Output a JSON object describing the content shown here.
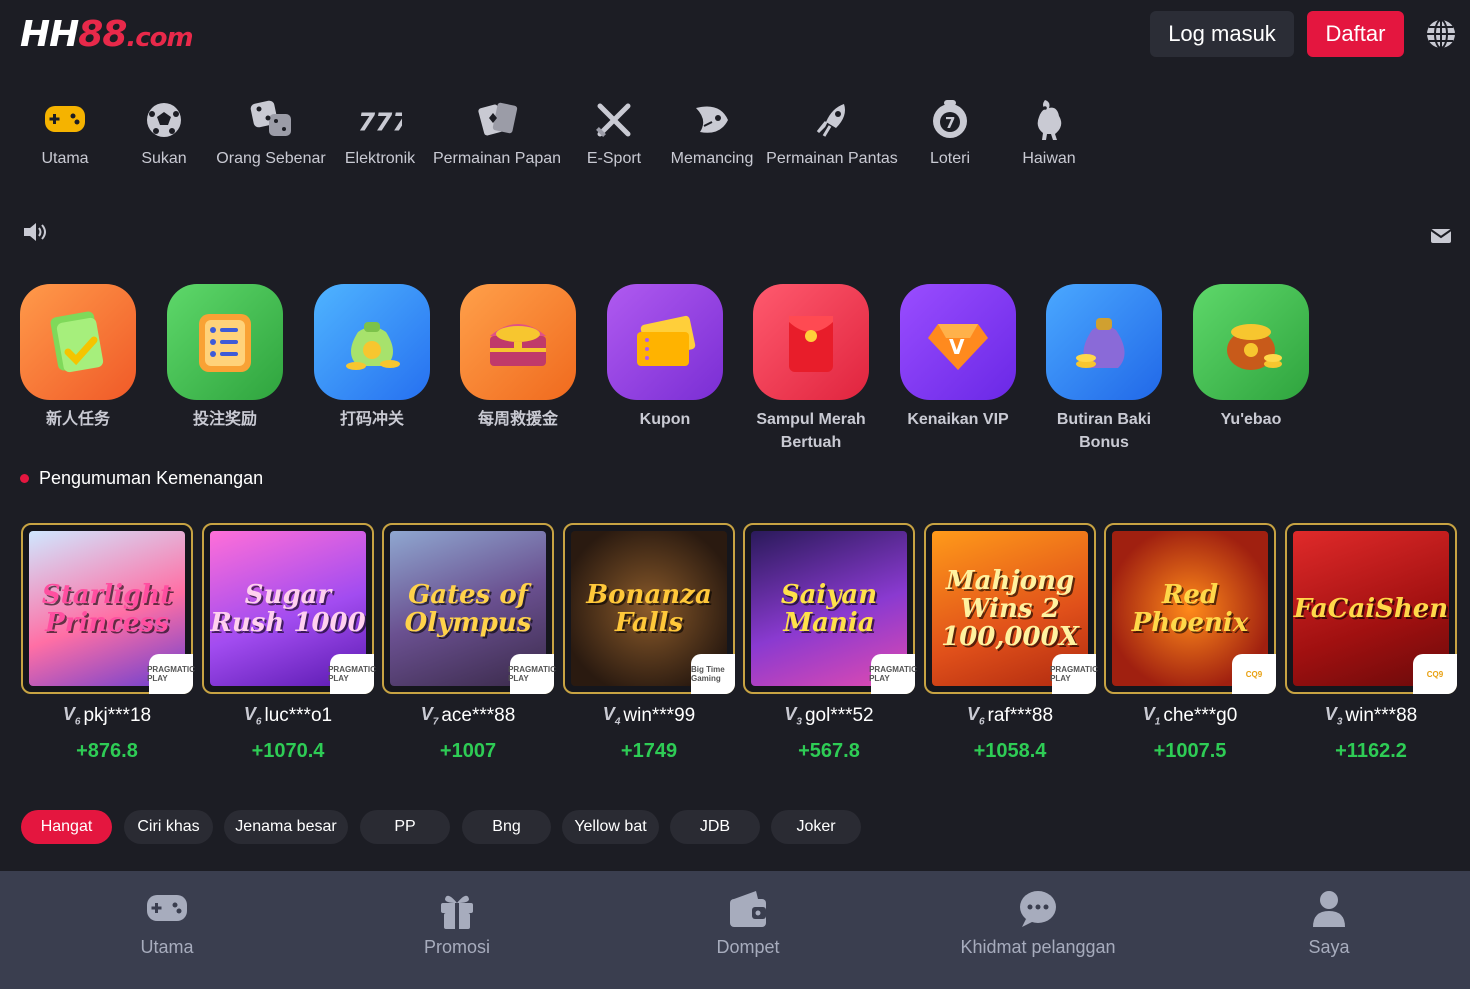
{
  "header": {
    "logo": {
      "part1": "HH",
      "part2": "88",
      "part3": ".com"
    },
    "login_label": "Log masuk",
    "register_label": "Daftar"
  },
  "categories": [
    {
      "label": "Utama",
      "icon": "gamepad-icon"
    },
    {
      "label": "Sukan",
      "icon": "soccer-ball-icon"
    },
    {
      "label": "Orang Sebenar",
      "icon": "dice-icon"
    },
    {
      "label": "Elektronik",
      "icon": "slot-777-icon"
    },
    {
      "label": "Permainan Papan",
      "icon": "cards-icon"
    },
    {
      "label": "E-Sport",
      "icon": "crossed-swords-icon"
    },
    {
      "label": "Memancing",
      "icon": "fish-icon"
    },
    {
      "label": "Permainan Pantas",
      "icon": "rocket-icon"
    },
    {
      "label": "Loteri",
      "icon": "lottery-ball-icon"
    },
    {
      "label": "Haiwan",
      "icon": "rooster-icon"
    }
  ],
  "promos": [
    {
      "label": "新人任务",
      "icon": "checklist-icon"
    },
    {
      "label": "投注奖励",
      "icon": "list-icon"
    },
    {
      "label": "打码冲关",
      "icon": "money-bag-icon"
    },
    {
      "label": "每周救援金",
      "icon": "treasure-chest-icon"
    },
    {
      "label": "Kupon",
      "icon": "coupon-icon"
    },
    {
      "label": "Sampul Merah Bertuah",
      "icon": "red-envelope-icon"
    },
    {
      "label": "Kenaikan VIP",
      "icon": "vip-diamond-icon"
    },
    {
      "label": "Butiran Baki Bonus",
      "icon": "coin-bag-icon"
    },
    {
      "label": "Yu'ebao",
      "icon": "gold-pot-icon"
    }
  ],
  "announcement_title": "Pengumuman Kemenangan",
  "winners": [
    {
      "game": "Starlight Princess",
      "vip": "6",
      "user": "pkj***18",
      "amount": "+876.8",
      "provider": "PRAGMATIC PLAY"
    },
    {
      "game": "Sugar Rush 1000",
      "vip": "6",
      "user": "luc***o1",
      "amount": "+1070.4",
      "provider": "PRAGMATIC PLAY"
    },
    {
      "game": "Gates of Olympus",
      "vip": "7",
      "user": "ace***88",
      "amount": "+1007",
      "provider": "PRAGMATIC PLAY"
    },
    {
      "game": "Bonanza Falls",
      "vip": "4",
      "user": "win***99",
      "amount": "+1749",
      "provider": "Big Time Gaming"
    },
    {
      "game": "Saiyan Mania",
      "vip": "3",
      "user": "gol***52",
      "amount": "+567.8",
      "provider": "PRAGMATIC PLAY"
    },
    {
      "game": "Mahjong Wins 2 100,000X",
      "vip": "6",
      "user": "raf***88",
      "amount": "+1058.4",
      "provider": "PRAGMATIC PLAY"
    },
    {
      "game": "Red Phoenix",
      "vip": "1",
      "user": "che***g0",
      "amount": "+1007.5",
      "provider": "CQ9"
    },
    {
      "game": "FaCaiShen",
      "vip": "3",
      "user": "win***88",
      "amount": "+1162.2",
      "provider": "CQ9"
    }
  ],
  "filters": [
    "Hangat",
    "Ciri khas",
    "Jenama besar",
    "PP",
    "Bng",
    "Yellow bat",
    "JDB",
    "Joker"
  ],
  "active_filter": "Hangat",
  "bottom_nav": [
    {
      "label": "Utama",
      "icon": "gamepad-icon"
    },
    {
      "label": "Promosi",
      "icon": "gift-icon"
    },
    {
      "label": "Dompet",
      "icon": "wallet-icon"
    },
    {
      "label": "Khidmat pelanggan",
      "icon": "chat-icon"
    },
    {
      "label": "Saya",
      "icon": "user-icon"
    }
  ],
  "colors": {
    "accent": "#e4163f",
    "background": "#1c1d24",
    "win_green": "#2ecc55",
    "card_border": "#c7a343"
  }
}
